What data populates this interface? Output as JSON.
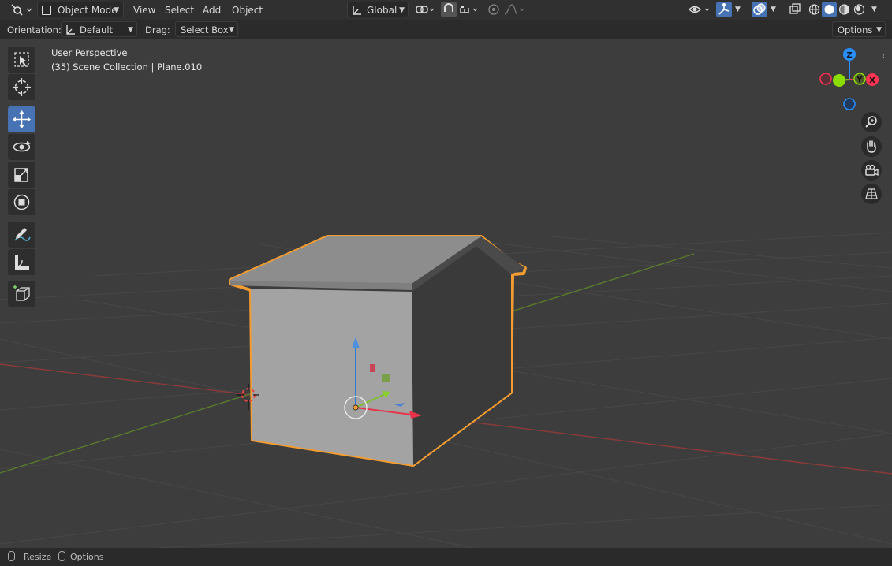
{
  "header": {
    "mode_label": "Object Mode",
    "menus": [
      "View",
      "Select",
      "Add",
      "Object"
    ],
    "transform_space": "Global"
  },
  "tool_settings": {
    "orientation_label": "Orientation:",
    "orientation_value": "Default",
    "drag_label": "Drag:",
    "drag_value": "Select Box",
    "options_label": "Options"
  },
  "viewport": {
    "perspective": "User Perspective",
    "collection_info": "(35) Scene Collection | Plane.010",
    "gizmo_axes": {
      "z": "Z",
      "y": "Y",
      "x": "X"
    }
  },
  "toolbar": {
    "tools": [
      "select-box",
      "cursor",
      "move",
      "rotate",
      "scale",
      "transform",
      "annotate",
      "measure",
      "add-cube"
    ],
    "active_tool": "move"
  },
  "statusbar": {
    "resize_label": "Resize",
    "options_label": "Options"
  },
  "colors": {
    "selection_outline": "#f39c32",
    "active_tool": "#4772b3",
    "axis_x": "#ff3352",
    "axis_y": "#8bdc00",
    "axis_z": "#2890ff"
  }
}
